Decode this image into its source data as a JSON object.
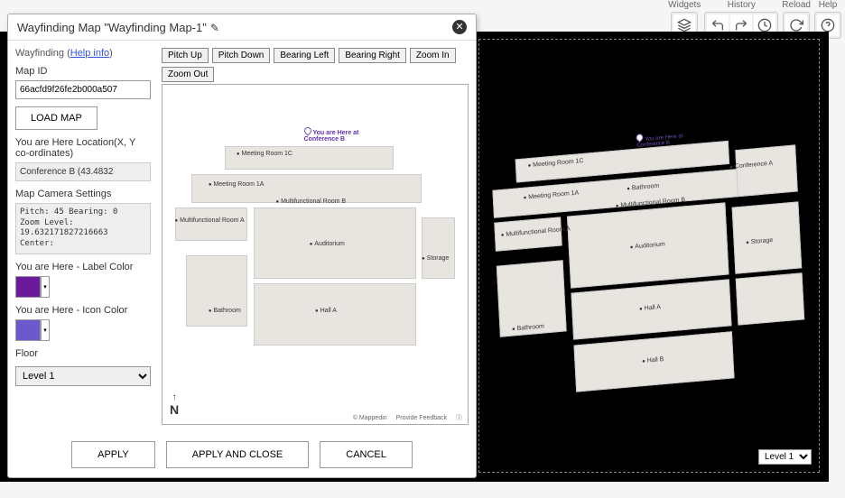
{
  "toolbar": {
    "widgets_label": "Widgets",
    "history_label": "History",
    "reload_label": "Reload",
    "help_label": "Help"
  },
  "canvas": {
    "level_selected": "Level 1",
    "rooms": {
      "meeting_1c": "Meeting Room 1C",
      "meeting_1a": "Meeting Room 1A",
      "conf_a": "Conference A",
      "bathroom1": "Bathroom",
      "multi_b": "Multifunctional Room B",
      "multi_a": "Multifunctional Room A",
      "auditorium": "Auditorium",
      "storage": "Storage",
      "hall_a": "Hall A",
      "hall_b": "Hall B",
      "bathroom2": "Bathroom"
    },
    "you_here": "You are Here at\nConference B"
  },
  "dialog": {
    "title": "Wayfinding Map \"Wayfinding Map-1\"",
    "panel": {
      "section": "Wayfinding",
      "help": "Help info",
      "map_id_label": "Map ID",
      "map_id_value": "66acfd9f26fe2b000a507",
      "load_btn": "LOAD MAP",
      "you_here_label": "You are Here Location(X, Y co-ordinates)",
      "you_here_value": "Conference B (43.4832",
      "camera_label": "Map Camera Settings",
      "camera_value": "Pitch: 45 Bearing: 0\nZoom Level:\n19.632171827216663\nCenter:",
      "label_color_label": "You are Here - Label Color",
      "label_color": "#6a1a9a",
      "icon_color_label": "You are Here - Icon Color",
      "icon_color": "#6a5acd",
      "floor_label": "Floor",
      "floor_value": "Level 1"
    },
    "controls": {
      "pitch_up": "Pitch Up",
      "pitch_down": "Pitch Down",
      "bearing_left": "Bearing Left",
      "bearing_right": "Bearing Right",
      "zoom_in": "Zoom In",
      "zoom_out": "Zoom Out"
    },
    "preview": {
      "compass": "N",
      "credit": "© Mappedin",
      "feedback": "Provide Feedback",
      "you_here": "You are Here at\nConference B",
      "rooms": {
        "meeting_1c": "Meeting Room 1C",
        "meeting_1a": "Meeting Room 1A",
        "multi_b": "Multifunctional Room B",
        "multi_a": "Multifunctional Room A",
        "auditorium": "Auditorium",
        "storage": "Storage",
        "hall_a": "Hall A",
        "bathroom": "Bathroom"
      }
    },
    "footer": {
      "apply": "APPLY",
      "apply_close": "APPLY AND CLOSE",
      "cancel": "CANCEL"
    }
  }
}
